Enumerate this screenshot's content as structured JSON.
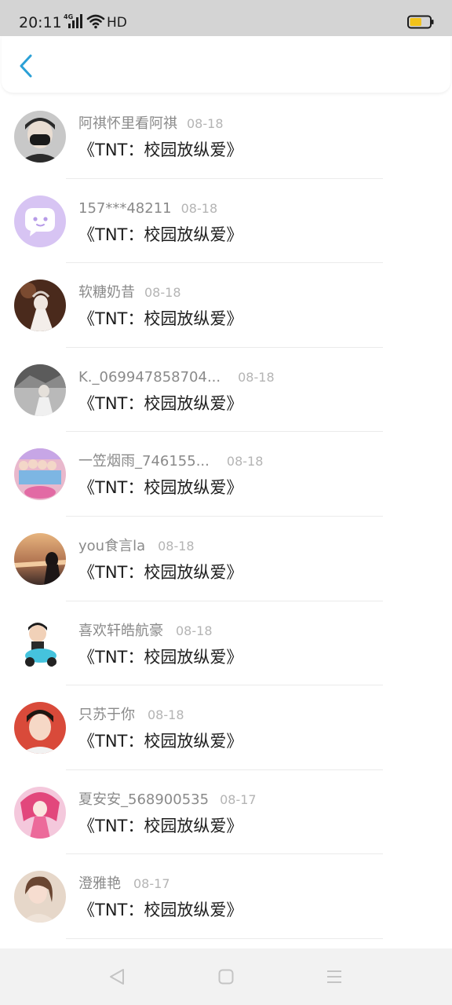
{
  "status_bar": {
    "time": "20:11",
    "network": "4G",
    "hd": "HD",
    "battery_level": 0.6,
    "battery_color": "#f2c31b"
  },
  "header": {
    "back_icon": "chevron-left-icon",
    "accent_color": "#2ba0d6"
  },
  "list": [
    {
      "name": "阿祺怀里看阿祺",
      "date": "08-18",
      "content": "《TNT：校园放纵爱》"
    },
    {
      "name": "157***48211",
      "date": "08-18",
      "content": "《TNT：校园放纵爱》"
    },
    {
      "name": "软糖奶昔",
      "date": "08-18",
      "content": "《TNT：校园放纵爱》"
    },
    {
      "name": "K._069947858704...",
      "date": "08-18",
      "content": "《TNT：校园放纵爱》"
    },
    {
      "name": "一笠烟雨_746155...",
      "date": "08-18",
      "content": "《TNT：校园放纵爱》"
    },
    {
      "name": "you食言la",
      "date": "08-18",
      "content": "《TNT：校园放纵爱》"
    },
    {
      "name": "喜欢轩皓航豪",
      "date": "08-18",
      "content": "《TNT：校园放纵爱》"
    },
    {
      "name": "只苏于你",
      "date": "08-18",
      "content": "《TNT：校园放纵爱》"
    },
    {
      "name": "夏安安_568900535",
      "date": "08-17",
      "content": "《TNT：校园放纵爱》"
    },
    {
      "name": "澄雅艳",
      "date": "08-17",
      "content": "《TNT：校园放纵爱》"
    }
  ],
  "nav_bar": {
    "back_icon": "triangle-back-icon",
    "home_icon": "square-home-icon",
    "menu_icon": "menu-lines-icon"
  }
}
